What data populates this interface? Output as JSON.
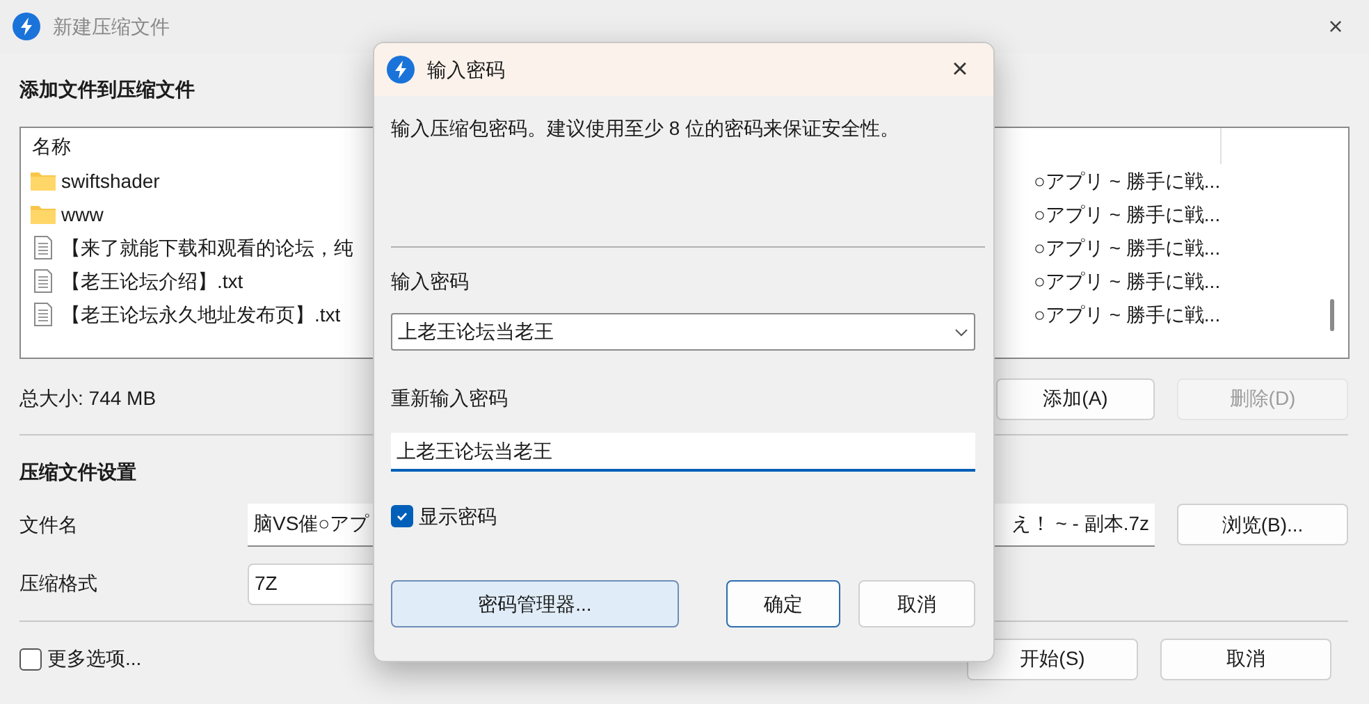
{
  "window": {
    "title": "新建压缩文件",
    "close": "×"
  },
  "add_section": {
    "heading": "添加文件到压缩文件",
    "file_list": {
      "columns": [
        "名称"
      ],
      "rows": [
        {
          "kind": "folder",
          "name": "swiftshader",
          "column_2": "○アプリ ~ 勝手に戦..."
        },
        {
          "kind": "folder",
          "name": "www",
          "column_2": "○アプリ ~ 勝手に戦..."
        },
        {
          "kind": "file",
          "name": "【来了就能下载和观看的论坛，纯",
          "column_2": "○アプリ ~ 勝手に戦..."
        },
        {
          "kind": "file",
          "name": "【老王论坛介绍】.txt",
          "column_2": "○アプリ ~ 勝手に戦..."
        },
        {
          "kind": "file",
          "name": "【老王论坛永久地址发布页】.txt",
          "column_2": "○アプリ ~ 勝手に戦..."
        }
      ]
    },
    "total_size": "总大小: 744 MB",
    "buttons": [
      {
        "label": "添加(A)",
        "disabled": false
      },
      {
        "label": "删除(D)",
        "disabled": true
      }
    ]
  },
  "settings": {
    "heading": "压缩文件设置",
    "file_name": {
      "label": "文件名",
      "value_start": "脑VS催○アプ",
      "value_end": "え！ ~ - 副本.7z",
      "browse": "浏览(B)..."
    },
    "format": {
      "label": "压缩格式",
      "value": "7Z"
    }
  },
  "more_options": {
    "label": "更多选项...",
    "checked": false
  },
  "footer_buttons": [
    {
      "label": "开始(S)"
    },
    {
      "label": "取消"
    }
  ],
  "dialog": {
    "title": "输入密码",
    "close": "×",
    "message": "输入压缩包密码。建议使用至少 8 位的密码来保证安全性。",
    "password_label": "输入密码",
    "password_value": "上老王论坛当老王",
    "confirm_label": "重新输入密码",
    "confirm_value": "上老王论坛当老王",
    "show_password": {
      "label": "显示密码",
      "checked": true
    },
    "buttons": [
      {
        "label": "密码管理器...",
        "kind": "manager"
      },
      {
        "label": "确定",
        "kind": "default"
      },
      {
        "label": "取消",
        "kind": "plain"
      }
    ]
  }
}
